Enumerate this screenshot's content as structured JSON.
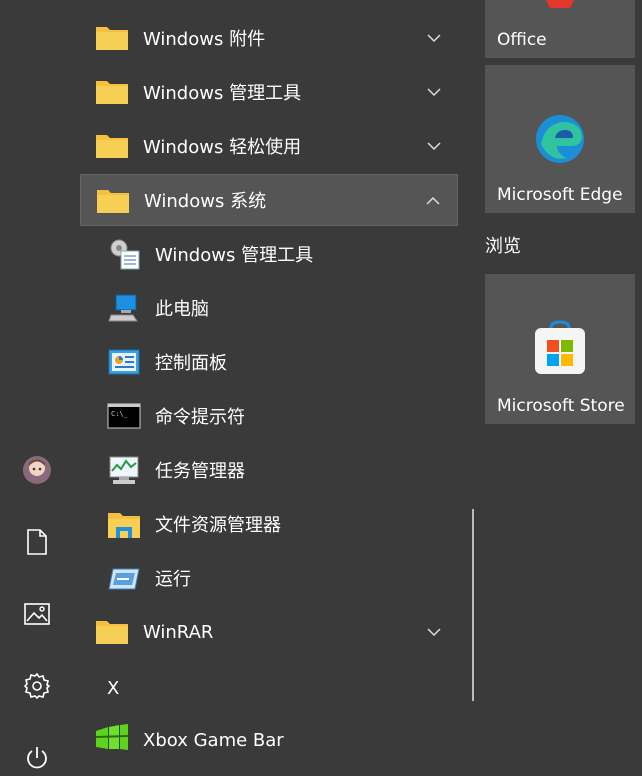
{
  "start_menu": {
    "app_list": [
      {
        "label": "Windows 附件",
        "type": "folder",
        "expanded": false
      },
      {
        "label": "Windows 管理工具",
        "type": "folder",
        "expanded": false
      },
      {
        "label": "Windows 轻松使用",
        "type": "folder",
        "expanded": false
      },
      {
        "label": "Windows 系统",
        "type": "folder",
        "expanded": true
      },
      {
        "label": "Windows 管理工具",
        "type": "app",
        "icon": "admin-tools-icon"
      },
      {
        "label": "此电脑",
        "type": "app",
        "icon": "this-pc-icon"
      },
      {
        "label": "控制面板",
        "type": "app",
        "icon": "control-panel-icon"
      },
      {
        "label": "命令提示符",
        "type": "app",
        "icon": "command-prompt-icon"
      },
      {
        "label": "任务管理器",
        "type": "app",
        "icon": "task-manager-icon"
      },
      {
        "label": "文件资源管理器",
        "type": "app",
        "icon": "file-explorer-icon"
      },
      {
        "label": "运行",
        "type": "app",
        "icon": "run-icon"
      },
      {
        "label": "WinRAR",
        "type": "folder",
        "expanded": false
      },
      {
        "label": "X",
        "type": "letter-header"
      },
      {
        "label": "Xbox Game Bar",
        "type": "app",
        "icon": "xbox-game-bar-icon"
      }
    ],
    "tiles": {
      "office": "Office",
      "edge": "Microsoft Edge",
      "group_label": "浏览",
      "store": "Microsoft Store"
    },
    "left_bar": [
      "user-avatar-icon",
      "documents-icon",
      "pictures-icon",
      "settings-icon",
      "power-icon"
    ],
    "colors": {
      "background": "#3a3a3a",
      "folder": "#f4c03e",
      "tile": "#555555"
    }
  }
}
